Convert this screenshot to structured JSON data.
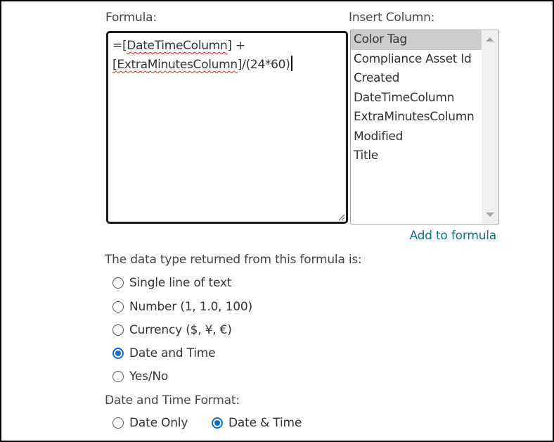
{
  "formula": {
    "label": "Formula:",
    "line1_prefix": "=[",
    "line1_token": "DateTimeColumn",
    "line1_suffix": "] +",
    "line2_prefix": "[",
    "line2_token": "ExtraMinutesColumn",
    "line2_suffix": "]/(24*60)"
  },
  "insert_column": {
    "label": "Insert Column:",
    "items": [
      {
        "label": "Color Tag",
        "selected": true
      },
      {
        "label": "Compliance Asset Id",
        "selected": false
      },
      {
        "label": "Created",
        "selected": false
      },
      {
        "label": "DateTimeColumn",
        "selected": false
      },
      {
        "label": "ExtraMinutesColumn",
        "selected": false
      },
      {
        "label": "Modified",
        "selected": false
      },
      {
        "label": "Title",
        "selected": false
      }
    ],
    "add_link": "Add to formula"
  },
  "data_type": {
    "label": "The data type returned from this formula is:",
    "options": [
      {
        "label": "Single line of text",
        "checked": false
      },
      {
        "label": "Number (1, 1.0, 100)",
        "checked": false
      },
      {
        "label": "Currency ($, ¥, €)",
        "checked": false
      },
      {
        "label": "Date and Time",
        "checked": true
      },
      {
        "label": "Yes/No",
        "checked": false
      }
    ]
  },
  "date_format": {
    "label": "Date and Time Format:",
    "options": [
      {
        "label": "Date Only",
        "checked": false
      },
      {
        "label": "Date & Time",
        "checked": true
      }
    ]
  },
  "colors": {
    "accent": "#0a6cde",
    "link": "#0b7a75",
    "selected_item_bg": "#cccccc",
    "spellcheck": "#e0202a"
  }
}
